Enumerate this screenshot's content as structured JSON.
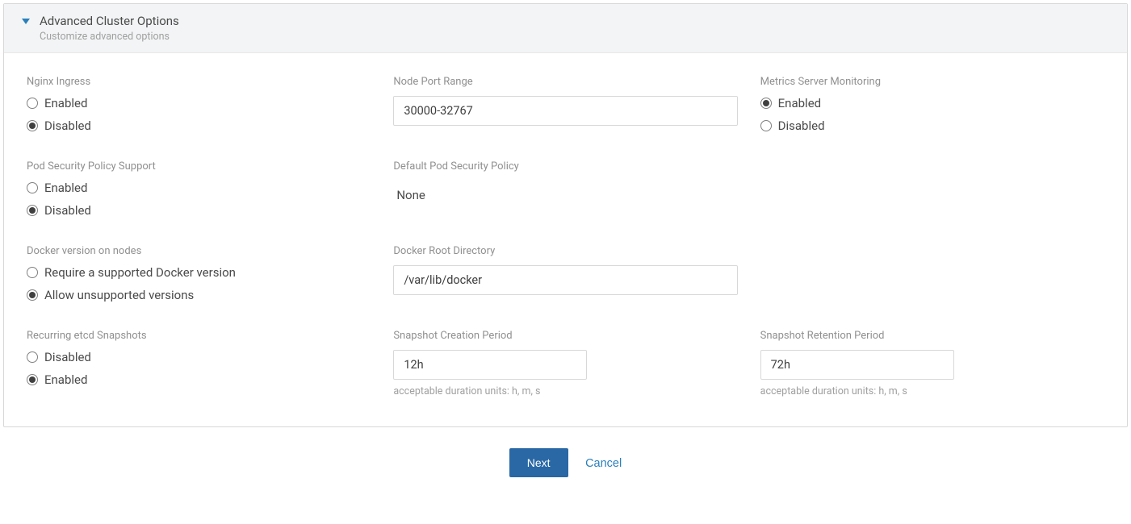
{
  "header": {
    "title": "Advanced Cluster Options",
    "subtitle": "Customize advanced options"
  },
  "fields": {
    "nginx_ingress": {
      "label": "Nginx Ingress",
      "enabled_label": "Enabled",
      "disabled_label": "Disabled",
      "selected": "Disabled"
    },
    "node_port_range": {
      "label": "Node Port Range",
      "value": "30000-32767"
    },
    "metrics_server": {
      "label": "Metrics Server Monitoring",
      "enabled_label": "Enabled",
      "disabled_label": "Disabled",
      "selected": "Enabled"
    },
    "pod_security_policy": {
      "label": "Pod Security Policy Support",
      "enabled_label": "Enabled",
      "disabled_label": "Disabled",
      "selected": "Disabled"
    },
    "default_pod_security_policy": {
      "label": "Default Pod Security Policy",
      "value": "None"
    },
    "docker_version": {
      "label": "Docker version on nodes",
      "require_label": "Require a supported Docker version",
      "allow_label": "Allow unsupported versions",
      "selected": "Allow unsupported versions"
    },
    "docker_root_directory": {
      "label": "Docker Root Directory",
      "value": "/var/lib/docker"
    },
    "etcd_snapshots": {
      "label": "Recurring etcd Snapshots",
      "disabled_label": "Disabled",
      "enabled_label": "Enabled",
      "selected": "Enabled"
    },
    "snapshot_creation_period": {
      "label": "Snapshot Creation Period",
      "value": "12h",
      "help": "acceptable duration units: h, m, s"
    },
    "snapshot_retention_period": {
      "label": "Snapshot Retention Period",
      "value": "72h",
      "help": "acceptable duration units: h, m, s"
    }
  },
  "footer": {
    "next_label": "Next",
    "cancel_label": "Cancel"
  }
}
